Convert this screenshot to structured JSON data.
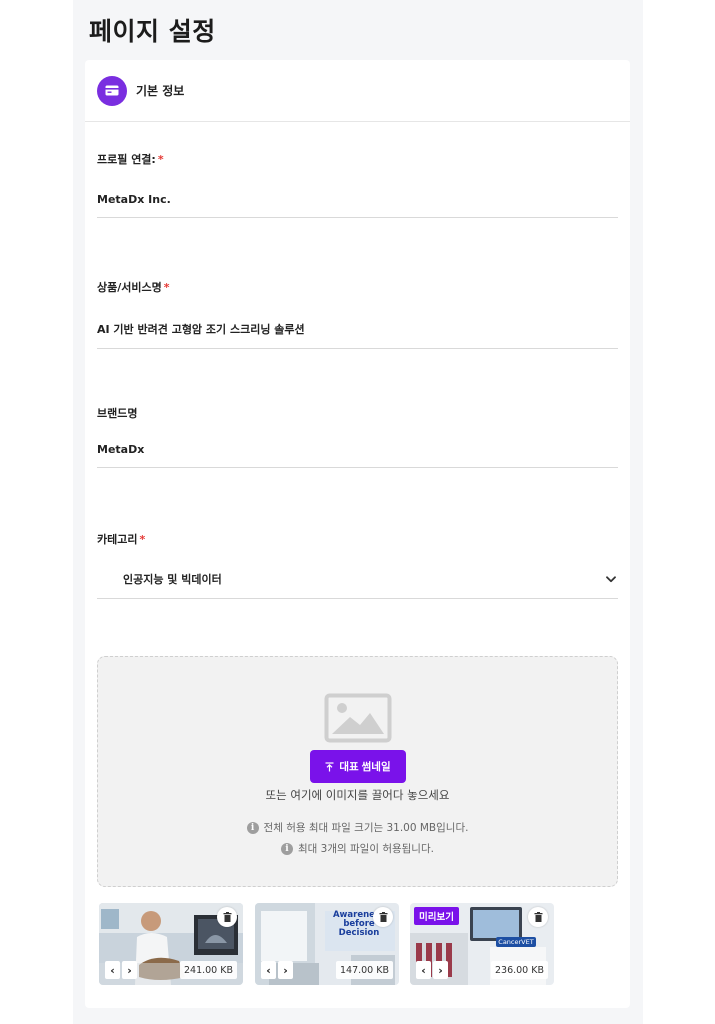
{
  "page": {
    "title": "페이지 설정"
  },
  "section": {
    "title": "기본 정보",
    "icon": "card-icon"
  },
  "fields": {
    "profile": {
      "label": "프로필 연결:",
      "required_mark": "*",
      "value": "MetaDx Inc."
    },
    "product": {
      "label": "상품/서비스명",
      "required_mark": "*",
      "value": "AI 기반 반려견 고형암 조기 스크리닝 솔루션"
    },
    "brand": {
      "label": "브랜드명",
      "value": "MetaDx"
    },
    "category": {
      "label": "카테고리",
      "required_mark": "*",
      "value": "인공지능 및 빅데이터",
      "icon": "chevron-down-icon"
    }
  },
  "upload": {
    "button_label": "대표 썸네일",
    "hint": "또는 여기에 이미지를 끌어다 놓으세요",
    "info_max_size": "전체 허용 최대 파일 크기는 31.00 MB입니다.",
    "info_max_count": "최대 3개의 파일이 허용됩니다.",
    "info_icon": "i"
  },
  "thumbnails": [
    {
      "size": "241.00 KB",
      "content": "veterinarian-ultrasound-photo"
    },
    {
      "size": "147.00 KB",
      "content": "clinic-room-photo",
      "overlay_text": [
        "Awareness",
        "before",
        "Decision"
      ]
    },
    {
      "size": "236.00 KB",
      "content": "lab-equipment-photo",
      "badge": "미리보기",
      "screen_label": "CancerVET"
    }
  ],
  "nav_arrows": {
    "prev": "‹",
    "next": "›"
  },
  "colors": {
    "accent": "#7a12ea",
    "required": "#e53935",
    "page_bg": "#f5f6f8"
  }
}
